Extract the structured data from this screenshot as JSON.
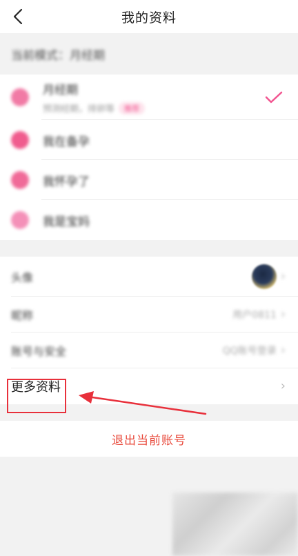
{
  "nav": {
    "title": "我的资料",
    "back_icon": "chevron-left-icon"
  },
  "mode_header": "当前模式：月经期",
  "modes": [
    {
      "title": "月经期",
      "desc": "预测经期，排卵等",
      "badge": "推荐",
      "color": "#f17aa5",
      "selected": true
    },
    {
      "title": "我在备孕",
      "color": "#f05c8e",
      "selected": false
    },
    {
      "title": "我怀孕了",
      "color": "#f06a98",
      "selected": false
    },
    {
      "title": "我是宝妈",
      "color": "#f490b8",
      "selected": false
    }
  ],
  "profile": {
    "avatar_label": "头像",
    "nickname_label": "昵称",
    "nickname_value": "用户0811",
    "account_label": "账号与安全",
    "account_value": "QQ账号登录",
    "more_label": "更多资料"
  },
  "logout_label": "退出当前账号",
  "colors": {
    "accent": "#f2538f",
    "logout": "#e8483a",
    "annotation": "#e8303b"
  }
}
